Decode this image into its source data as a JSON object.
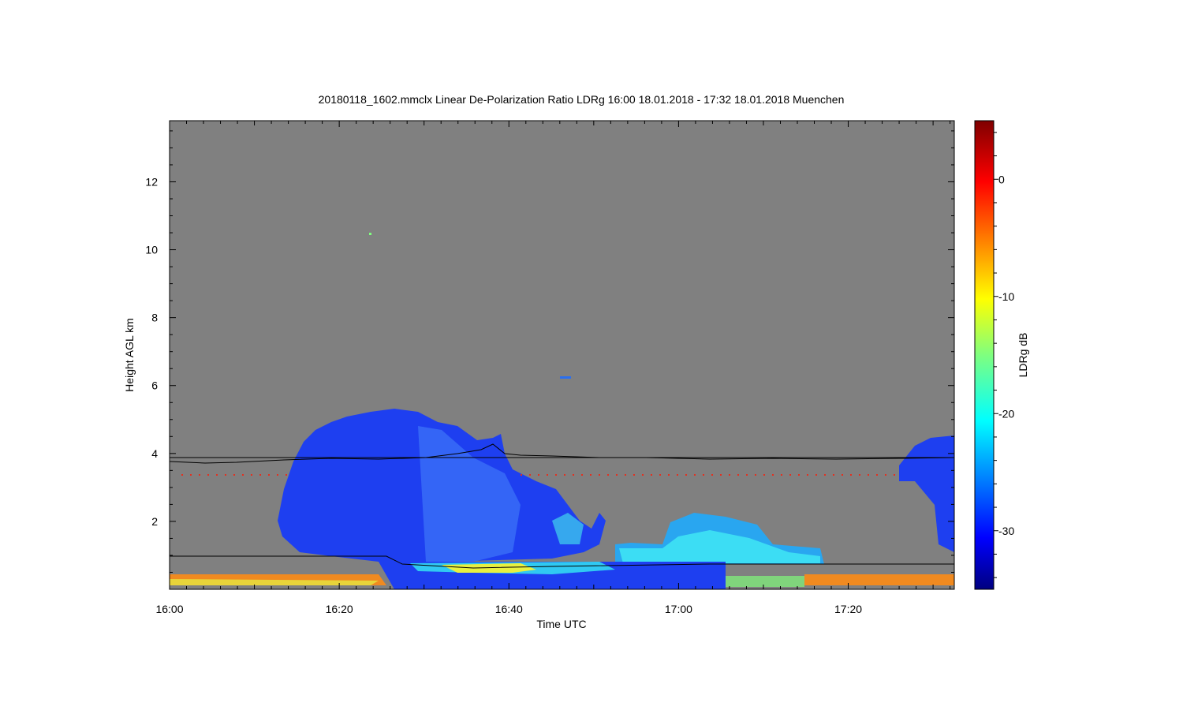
{
  "chart_data": {
    "type": "heatmap",
    "title": "20180118_1602.mmclx Linear De-Polarization Ratio LDRg   16:00 18.01.2018 - 17:32 18.01.2018 Muenchen",
    "xlabel": "Time UTC",
    "ylabel": "Height AGL km",
    "colorbar_label": "LDRg dB",
    "x_range_min": [
      0,
      92.5
    ],
    "y_range_km": [
      0,
      13.8
    ],
    "color_range_db": [
      -35,
      5
    ],
    "x_ticks": [
      {
        "label": "16:00",
        "value": 0
      },
      {
        "label": "16:20",
        "value": 20
      },
      {
        "label": "16:40",
        "value": 40
      },
      {
        "label": "17:00",
        "value": 60
      },
      {
        "label": "17:20",
        "value": 80
      }
    ],
    "y_ticks": [
      {
        "label": "2",
        "value": 2
      },
      {
        "label": "4",
        "value": 4
      },
      {
        "label": "6",
        "value": 6
      },
      {
        "label": "8",
        "value": 8
      },
      {
        "label": "10",
        "value": 10
      },
      {
        "label": "12",
        "value": 12
      }
    ],
    "colorbar_ticks": [
      {
        "label": "0",
        "value": 0
      },
      {
        "label": "-10",
        "value": -10
      },
      {
        "label": "-20",
        "value": -20
      },
      {
        "label": "-30",
        "value": -30
      }
    ],
    "background_color": "#808080",
    "melting_layer_km": 0.85,
    "isotherm_line_km": 4.0
  }
}
